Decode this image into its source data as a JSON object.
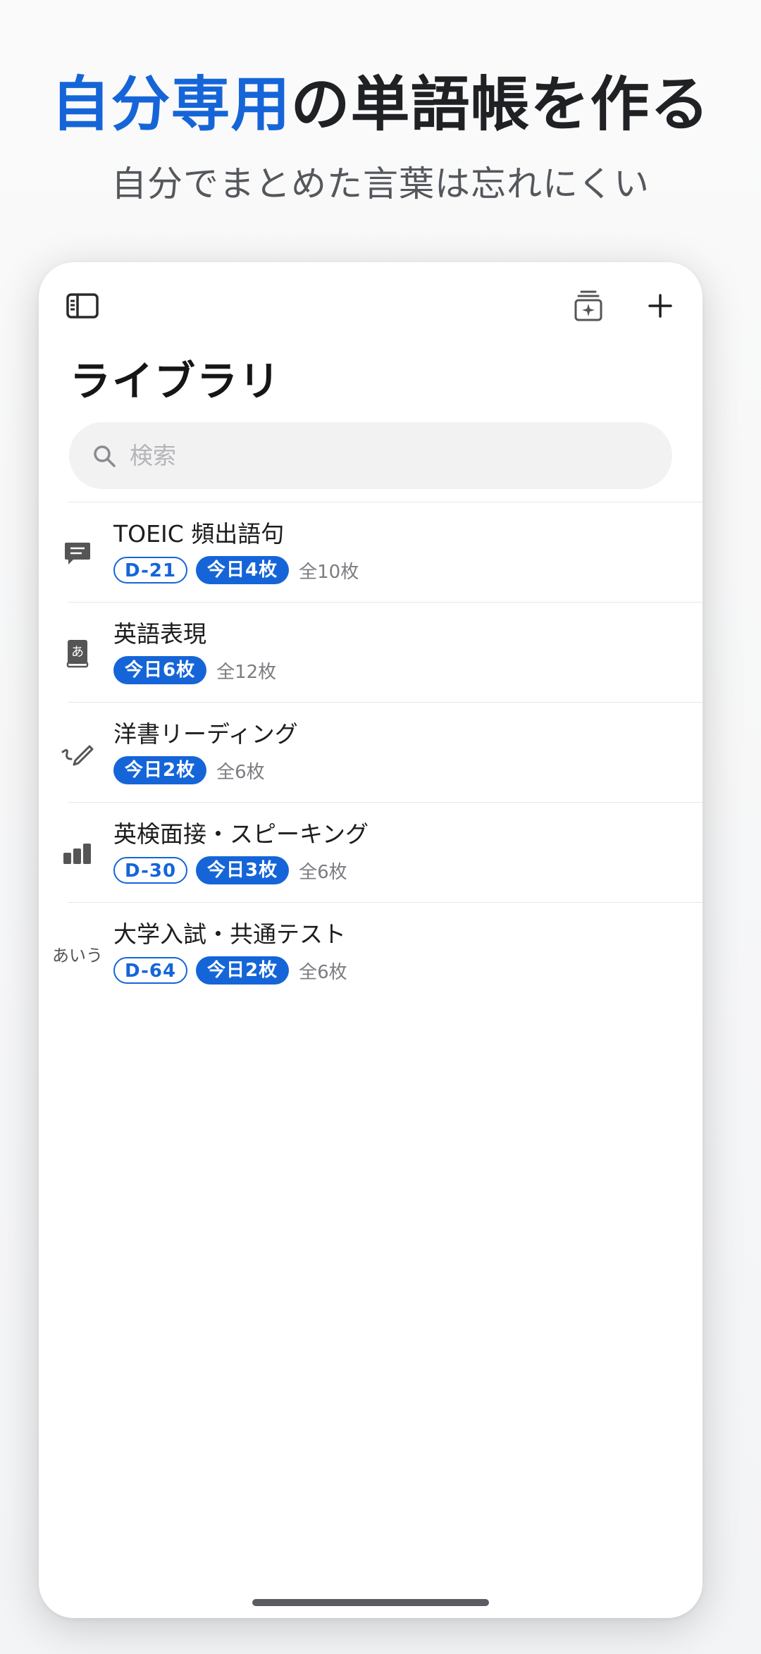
{
  "promo": {
    "title_accent": "自分専用",
    "title_rest": "の単語帳を作る",
    "subtitle": "自分でまとめた言葉は忘れにくい"
  },
  "toolbar": {
    "sidebar_icon": "sidebar-icon",
    "deck_icon": "card-stack-sparkle-icon",
    "add_icon": "plus-icon"
  },
  "page": {
    "title": "ライブラリ"
  },
  "search": {
    "placeholder": "検索",
    "value": ""
  },
  "colors": {
    "accent": "#1565d8",
    "text": "#1d1d1f",
    "muted": "#7c7d82"
  },
  "items": [
    {
      "icon": "chat-bubble-icon",
      "title": "TOEIC 頻出語句",
      "deadline": "D-21",
      "today": "今日4枚",
      "total": "全10枚"
    },
    {
      "icon": "dictionary-book-icon",
      "title": "英語表現",
      "deadline": "",
      "today": "今日6枚",
      "total": "全12枚"
    },
    {
      "icon": "handwriting-pencil-icon",
      "title": "洋書リーディング",
      "deadline": "",
      "today": "今日2枚",
      "total": "全6枚"
    },
    {
      "icon": "bar-chart-icon",
      "title": "英検面接・スピーキング",
      "deadline": "D-30",
      "today": "今日3枚",
      "total": "全6枚"
    },
    {
      "icon": "hiragana-text-icon",
      "icon_text": "あいう",
      "title": "大学入試・共通テスト",
      "deadline": "D-64",
      "today": "今日2枚",
      "total": "全6枚"
    }
  ]
}
